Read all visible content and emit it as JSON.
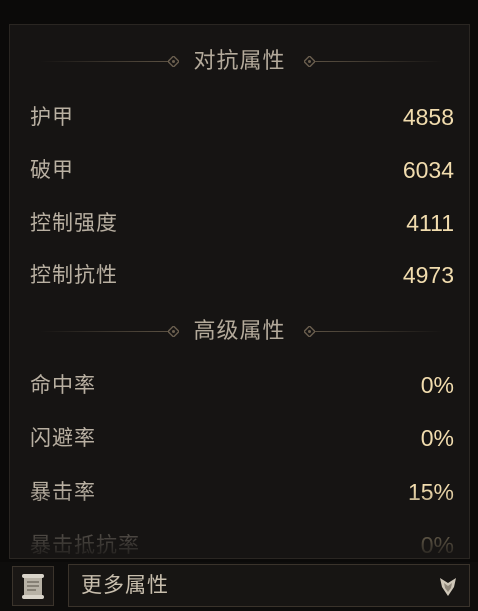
{
  "sections": [
    {
      "title": "对抗属性",
      "rows": [
        {
          "label": "护甲",
          "value": "4858"
        },
        {
          "label": "破甲",
          "value": "6034"
        },
        {
          "label": "控制强度",
          "value": "4111"
        },
        {
          "label": "控制抗性",
          "value": "4973"
        }
      ]
    },
    {
      "title": "高级属性",
      "rows": [
        {
          "label": "命中率",
          "value": "0%"
        },
        {
          "label": "闪避率",
          "value": "0%"
        },
        {
          "label": "暴击率",
          "value": "15%"
        },
        {
          "label": "暴击抵抗率",
          "value": "0%"
        }
      ]
    }
  ],
  "footer": {
    "more_label": "更多属性",
    "scroll_icon": "scroll-icon",
    "chevron_icon": "chevron-down-icon"
  },
  "colors": {
    "label": "#b9b0a2",
    "value": "#f1dcae",
    "header": "#b4aa9b"
  }
}
